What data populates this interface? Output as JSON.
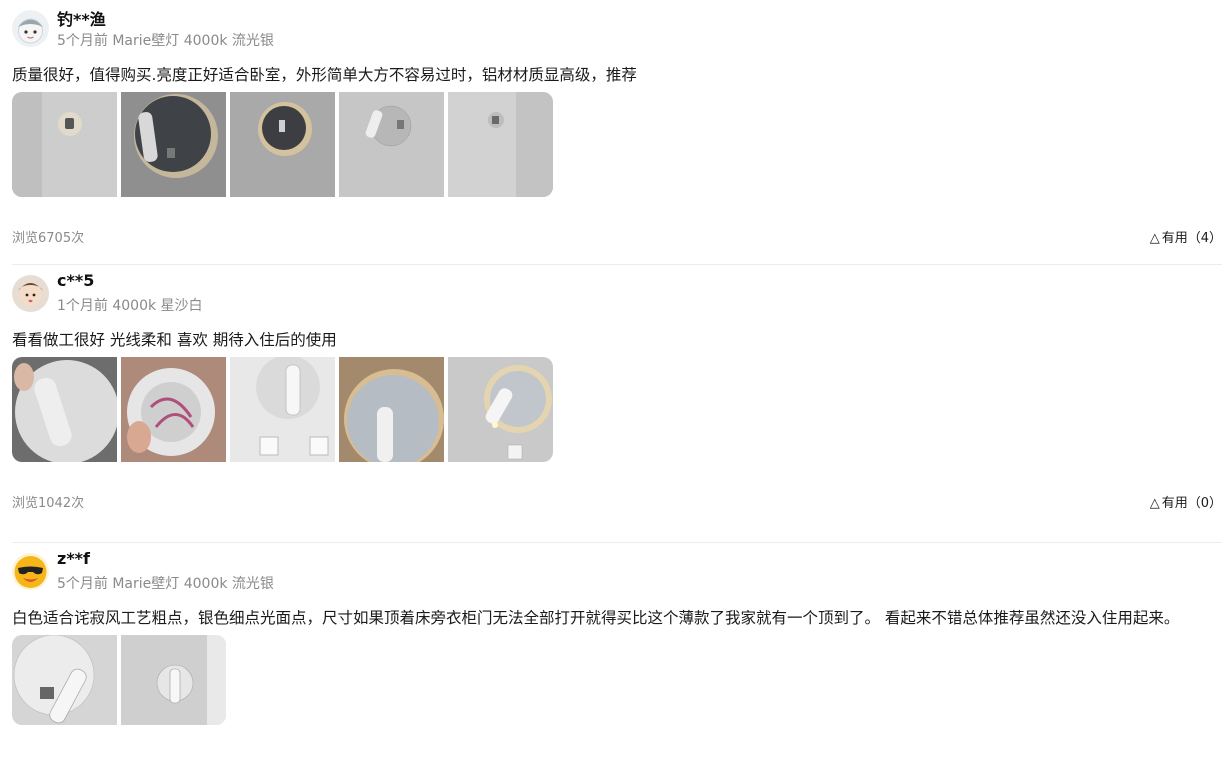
{
  "reviews": [
    {
      "user": "钓**渔",
      "meta": "5个月前 Marie壁灯 4000k 流光银",
      "text": "质量很好，值得购买.亮度正好适合卧室，外形简单大方不容易过时，铝材材质显高级，推荐",
      "views": "浏览6705次",
      "useful": "有用（4）",
      "avatar_icon": "cartoon-avatar-icon",
      "photo_count": 5
    },
    {
      "user": "c**5",
      "meta": "1个月前 4000k 星沙白",
      "text": "看看做工很好 光线柔和 喜欢 期待入住后的使用",
      "views": "浏览1042次",
      "useful": "有用（0）",
      "avatar_icon": "child-photo-avatar-icon",
      "photo_count": 5
    },
    {
      "user": "z**f",
      "meta": "5个月前 Marie壁灯 4000k 流光银",
      "text": "白色适合诧寂风工艺粗点，银色细点光面点，尺寸如果顶着床旁衣柜门无法全部打开就得买比这个薄款了我家就有一个顶到了。 看起来不错总体推荐虽然还没入住用起来。",
      "avatar_icon": "sunglasses-duck-avatar-icon",
      "photo_count": 2
    }
  ],
  "colors": {
    "meta_gray": "#8a8a8a",
    "divider": "#ececec",
    "wall_gray": "#cfcfcf"
  }
}
